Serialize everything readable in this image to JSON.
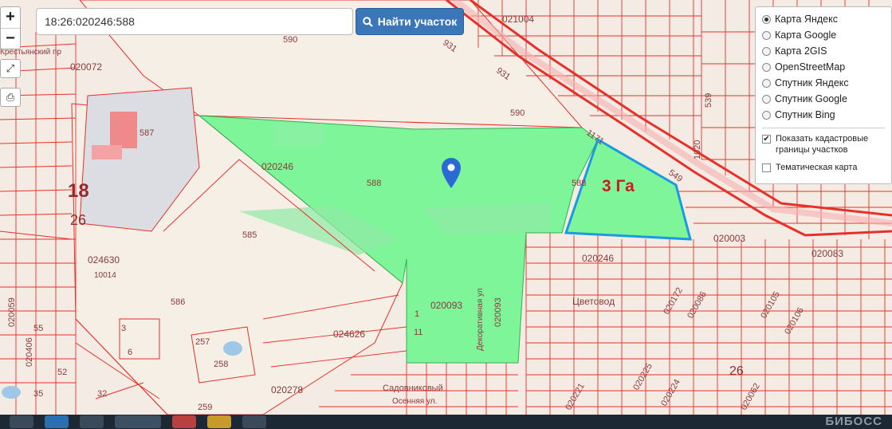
{
  "search": {
    "value": "18:26:020246:588",
    "button_label": "Найти участок"
  },
  "zoom": {
    "in": "+",
    "out": "−"
  },
  "tools": {
    "fullscreen_icon": "expand-icon",
    "print_icon": "printer-icon"
  },
  "layers": {
    "options": [
      {
        "label": "Карта Яндекс",
        "selected": true
      },
      {
        "label": "Карта Google",
        "selected": false
      },
      {
        "label": "Карта 2GIS",
        "selected": false
      },
      {
        "label": "OpenStreetMap",
        "selected": false
      },
      {
        "label": "Спутник Яндекс",
        "selected": false
      },
      {
        "label": "Спутник Google",
        "selected": false
      },
      {
        "label": "Спутник Bing",
        "selected": false
      }
    ],
    "show_cadastral": {
      "label": "Показать кадастровые границы участков",
      "checked": true
    },
    "thematic": {
      "label": "Тематическая карта",
      "checked": false
    }
  },
  "map": {
    "area_label": "3 Га",
    "highlight_color": "#7ff59a",
    "boundary_color": "#e8302a",
    "outline_color": "#1a9ae0",
    "labels": {
      "l590a": "590",
      "l590b": "590",
      "l931a": "931",
      "l931b": "931",
      "l021004": "021004",
      "l1171": "1171",
      "l549": "549",
      "l587": "587",
      "l020246a": "020246",
      "l588a": "588",
      "l588b": "588",
      "l585": "585",
      "l586": "586",
      "l18": "18",
      "l26": "26",
      "l020072": "020072",
      "l024630": "024630",
      "l10014": "10014",
      "l020093": "020093",
      "l020093v": "020093",
      "l020246b": "020246",
      "l020003": "020003",
      "l020083": "020083",
      "lTsvetovod": "Цветовод",
      "l024626": "024626",
      "l3": "3",
      "l6": "6",
      "l257": "257",
      "l258": "258",
      "l259": "259",
      "l020278": "020278",
      "lOsen": "Осенняя ул.",
      "l26b": "26",
      "l1020": "1020",
      "l539": "539",
      "l1b": "1",
      "l11": "11",
      "l020406": "020406",
      "l55": "55",
      "l52": "52",
      "l32": "32",
      "l35": "35",
      "l020059": "020059",
      "lKrest": "Крестьянский пр",
      "lDekor": "Декоративная ул",
      "lSad": "Садовниковый",
      "l020172": "020172",
      "l020086": "020086",
      "l020105": "020105",
      "l020106": "020106",
      "l020225": "020225",
      "l020224": "020224",
      "l020221": "020221",
      "l020062": "020062"
    }
  },
  "taskbar": {
    "watermark": "БИБОСС"
  }
}
